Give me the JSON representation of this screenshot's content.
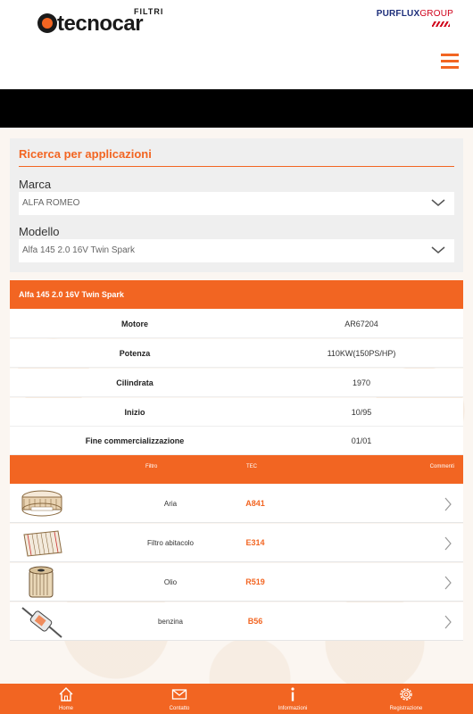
{
  "header": {
    "brand_filtri": "FILTRI",
    "brand_name": "tecnocar",
    "partner_name": "PURFLUX",
    "partner_group": "GROUP"
  },
  "search": {
    "title": "Ricerca per applicazioni",
    "marca_label": "Marca",
    "marca_value": "ALFA ROMEO",
    "modello_label": "Modello",
    "modello_value": "Alfa 145 2.0 16V Twin Spark"
  },
  "vehicle": {
    "title": "Alfa 145 2.0 16V Twin Spark",
    "specs": [
      {
        "label": "Motore",
        "value": "AR67204"
      },
      {
        "label": "Potenza",
        "value": "110KW(150PS/HP)"
      },
      {
        "label": "Cilindrata",
        "value": "1970"
      },
      {
        "label": "Inizio",
        "value": "10/95"
      },
      {
        "label": "Fine commercializzazione",
        "value": "01/01"
      }
    ]
  },
  "filters_table": {
    "columns": {
      "filtro": "Filtro",
      "tec": "TEC",
      "commenti": "Commenti"
    },
    "rows": [
      {
        "name": "Aria",
        "code": "A841",
        "icon": "air-filter-icon"
      },
      {
        "name": "Filtro abitacolo",
        "code": "E314",
        "icon": "cabin-filter-icon"
      },
      {
        "name": "Olio",
        "code": "R519",
        "icon": "oil-filter-icon"
      },
      {
        "name": "benzina",
        "code": "B56",
        "icon": "fuel-filter-icon"
      }
    ]
  },
  "bottom_nav": {
    "items": [
      {
        "label": "Home",
        "icon": "home-icon"
      },
      {
        "label": "Contatto",
        "icon": "mail-icon"
      },
      {
        "label": "Informazioni",
        "icon": "info-icon"
      },
      {
        "label": "Registrazione",
        "icon": "gear-icon"
      }
    ]
  },
  "colors": {
    "accent": "#f26522",
    "partner_blue": "#1d2e7a",
    "partner_red": "#d0021b"
  }
}
